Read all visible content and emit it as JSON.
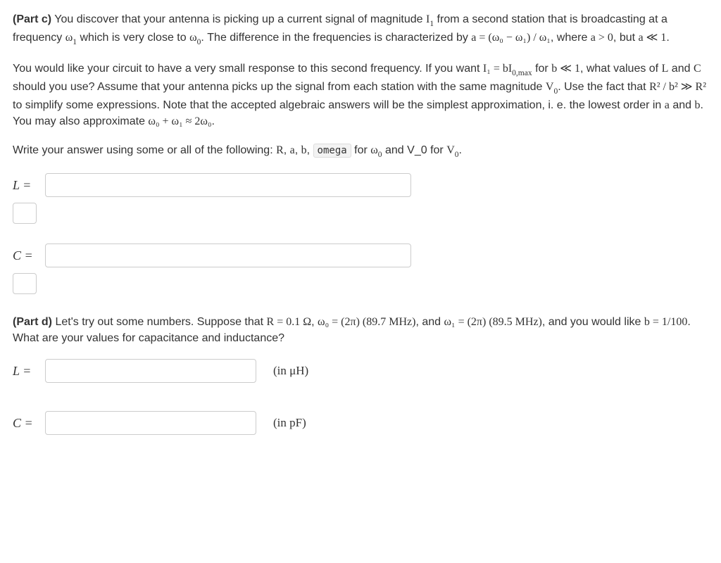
{
  "partC": {
    "heading": "(Part c)",
    "p1_a": " You discover that your antenna is picking up a current signal of magnitude ",
    "p1_I1": "I",
    "p1_I1sub": "1",
    "p1_b": " from a second station that is broadcasting at a frequency ",
    "p1_w1": "ω",
    "p1_w1sub": "1",
    "p1_c": " which is very close to ",
    "p1_w0": "ω",
    "p1_w0sub": "0",
    "p1_d": ". The difference in the frequencies is characterized by ",
    "p1_eq": "a = (ω₀ − ω₁) / ω₁",
    "p1_e": ", where ",
    "p1_cond1": "a > 0",
    "p1_f": ", but ",
    "p1_cond2": "a ≪ 1",
    "p1_g": ".",
    "p2_a": "You would like your circuit to have a very small response to this second frequency. If you want ",
    "p2_eq1": "I₁ = bI",
    "p2_eq1sub": "0,max",
    "p2_b": " for ",
    "p2_cond": "b ≪ 1",
    "p2_c": ", what values of ",
    "p2_L": "L",
    "p2_d": " and ",
    "p2_C": "C",
    "p2_e": " should you use? Assume that your antenna picks up the signal from each station with the same magnitude ",
    "p2_V0": "V",
    "p2_V0sub": "0",
    "p2_f": ". Use the fact that ",
    "p2_eq2": "R² / b² ≫ R²",
    "p2_g": " to simplify some expressions. Note that the accepted algebraic answers will be the simplest approximation, i. e. the lowest order in ",
    "p2_a2": "a",
    "p2_h": " and ",
    "p2_b2": "b",
    "p2_i": ". You may also approximate ",
    "p2_eq3": "ω₀ + ω₁ ≈ 2ω₀",
    "p2_j": ".",
    "p3_a": "Write your answer using some or all of the following: ",
    "p3_R": "R",
    "p3_s1": ", ",
    "p3_av": "a",
    "p3_s2": ", ",
    "p3_bv": "b",
    "p3_s3": ", ",
    "p3_code": "omega",
    "p3_b": " for ",
    "p3_w0a": "ω",
    "p3_w0asub": "0",
    "p3_c": " and V_0 for ",
    "p3_V0a": "V",
    "p3_V0asub": "0",
    "p3_d": ".",
    "L_label": "L =",
    "C_label": "C ="
  },
  "partD": {
    "heading": "(Part d)",
    "p1_a": " Let's try out some numbers. Suppose that ",
    "p1_eq1": "R = 0.1 Ω",
    "p1_b": ", ",
    "p1_eq2": "ω₀ = (2π) (89.7 MHz)",
    "p1_c": ", and ",
    "p1_eq3": "ω₁ = (2π) (89.5 MHz)",
    "p1_d": ", and you would like ",
    "p1_eq4": "b = 1/100",
    "p1_e": ". What are your values for capacitance and inductance?",
    "L_label": "L =",
    "L_unit": "(in μH)",
    "C_label": "C =",
    "C_unit": "(in pF)"
  },
  "inputs": {
    "L_c": "",
    "C_c": "",
    "L_d": "",
    "C_d": ""
  }
}
